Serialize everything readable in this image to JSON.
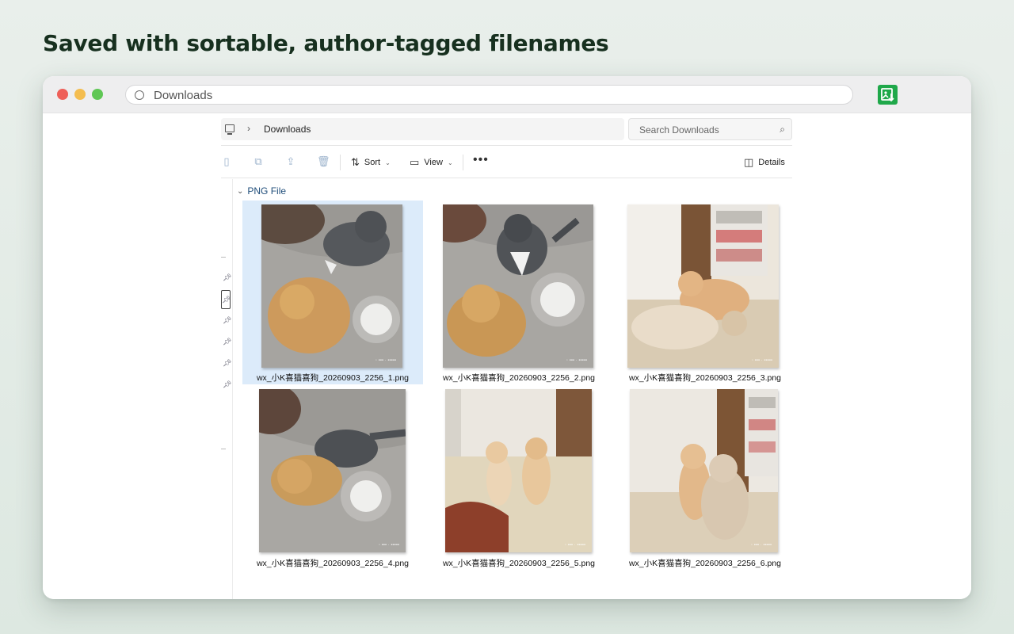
{
  "headline": "Saved with sortable, author-tagged filenames",
  "browser": {
    "url_text": "Downloads"
  },
  "explorer": {
    "breadcrumb": "Downloads",
    "search_placeholder": "Search Downloads",
    "toolbar": {
      "sort_label": "Sort",
      "view_label": "View",
      "details_label": "Details"
    },
    "group_label": "PNG File",
    "files": [
      {
        "name": "wx_小K喜猫喜狗_20260903_2256_1.png",
        "selected": true
      },
      {
        "name": "wx_小K喜猫喜狗_20260903_2256_2.png",
        "selected": false
      },
      {
        "name": "wx_小K喜猫喜狗_20260903_2256_3.png",
        "selected": false
      },
      {
        "name": "wx_小K喜猫喜狗_20260903_2256_4.png",
        "selected": false
      },
      {
        "name": "wx_小K喜猫喜狗_20260903_2256_5.png",
        "selected": false
      },
      {
        "name": "wx_小K喜猫喜狗_20260903_2256_6.png",
        "selected": false
      }
    ]
  },
  "icons": {
    "url": "globe-icon",
    "extension": "image-download-icon",
    "pc": "computer-icon",
    "search": "search-icon",
    "pin": "pin-icon"
  },
  "colors": {
    "selection": "#dcebfa",
    "group_label": "#1f4d7a",
    "extension_icon": "#1fa84a"
  }
}
